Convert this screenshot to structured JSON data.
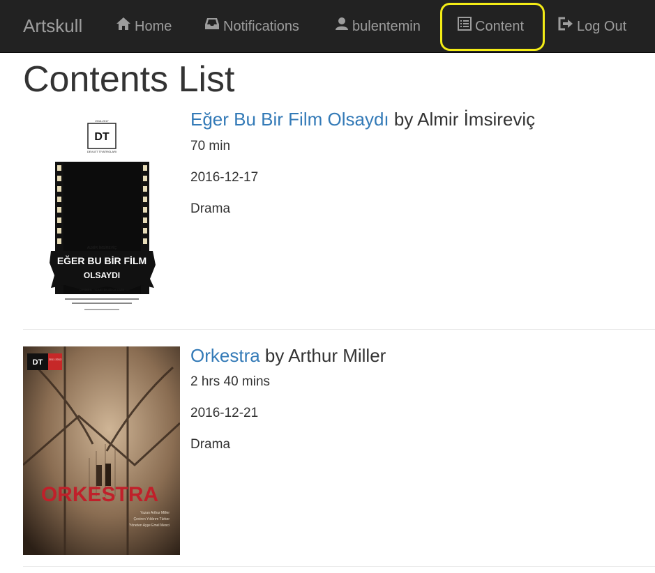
{
  "nav": {
    "brand": "Artskull",
    "items": [
      {
        "label": "Home",
        "icon": "home-icon"
      },
      {
        "label": "Notifications",
        "icon": "inbox-icon"
      },
      {
        "label": "bulentemin",
        "icon": "user-icon"
      },
      {
        "label": "Content",
        "icon": "list-icon"
      },
      {
        "label": "Log Out",
        "icon": "log-out-icon"
      }
    ],
    "highlight_color": "#f4ec16"
  },
  "page": {
    "title": "Contents List"
  },
  "contents": [
    {
      "title": "Eğer Bu Bir Film Olsaydı",
      "by": "by",
      "author": "Almir İmsireviç",
      "duration": "70 min",
      "date": "2016-12-17",
      "genre": "Drama",
      "poster": {
        "logo": "DT",
        "small_top": "DEVLET TİYATROLARI",
        "author_line": "ALMİR İMSİREVİÇ",
        "title_line1": "EĞER BU BİR FİLM",
        "title_line2": "OLSAYDI",
        "credit": "ÇEVİREN · YÖNETEN BİLGE EMİN"
      }
    },
    {
      "title": "Orkestra",
      "by": "by",
      "author": "Arthur Miller",
      "duration": "2 hrs 40 mins",
      "date": "2016-12-21",
      "genre": "Drama",
      "poster": {
        "logo": "DT",
        "season": "2011 2012",
        "poster_title": "ORKESTRA",
        "credit1": "Yazan Arthur Miller",
        "credit2": "Çeviren Yıldırım Türker",
        "credit3": "Yöneten Ayşe Emel Mesci"
      }
    }
  ]
}
